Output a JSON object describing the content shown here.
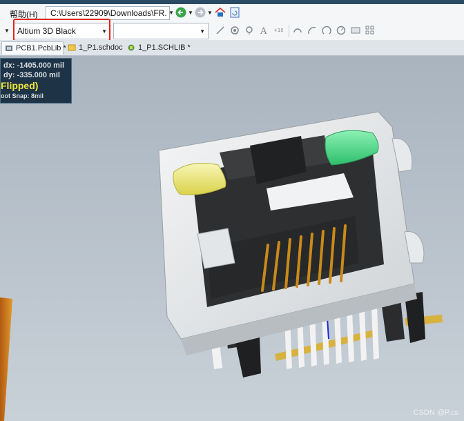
{
  "menubar": {
    "help_menu": "帮助(H)",
    "path": "C:\\Users\\22909\\Downloads\\FR."
  },
  "toolbar": {
    "view_config": "Altium 3D Black",
    "second_dropdown": ""
  },
  "tabs": [
    {
      "label": "PCB1.PcbLib *",
      "icon": "pcb-icon",
      "active": true
    },
    {
      "label": "1_P1.schdoc",
      "icon": "schematic-icon",
      "active": false
    },
    {
      "label": "1_P1.SCHLIB *",
      "icon": "schlib-icon",
      "active": false
    }
  ],
  "hud": {
    "dx": "dx: -1405.000  mil",
    "dy": "dy:  -335.000  mil",
    "flipped": "Flipped)",
    "snap": "oot Snap: 8mil"
  },
  "colors": {
    "background": "#b8c2cc",
    "led_left": "#f4ef8a",
    "led_right": "#4fd98a",
    "highlight": "#e0261f"
  },
  "watermark": "CSDN @P.cs"
}
